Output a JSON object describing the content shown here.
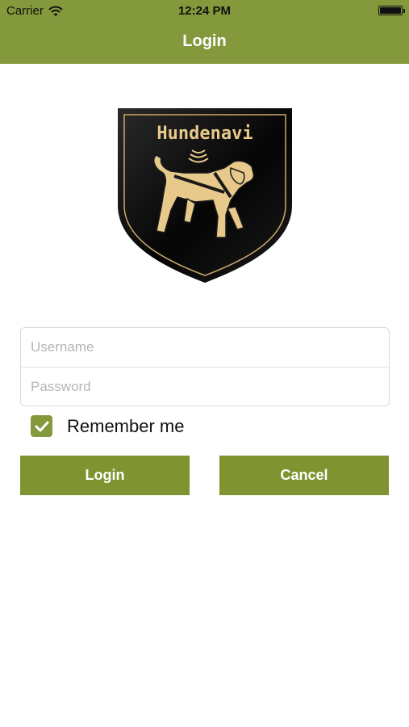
{
  "status_bar": {
    "carrier": "Carrier",
    "time": "12:24 PM",
    "battery_level": 1.0
  },
  "nav": {
    "title": "Login"
  },
  "logo": {
    "text": "Hundenavi",
    "icon": "dog-shield-logo"
  },
  "form": {
    "username_placeholder": "Username",
    "username_value": "",
    "password_placeholder": "Password",
    "password_value": ""
  },
  "remember": {
    "label": "Remember me",
    "checked": true
  },
  "buttons": {
    "login": "Login",
    "cancel": "Cancel"
  },
  "colors": {
    "accent": "#84993b",
    "button": "#7f9430",
    "logo_gold": "#e7c98b"
  }
}
